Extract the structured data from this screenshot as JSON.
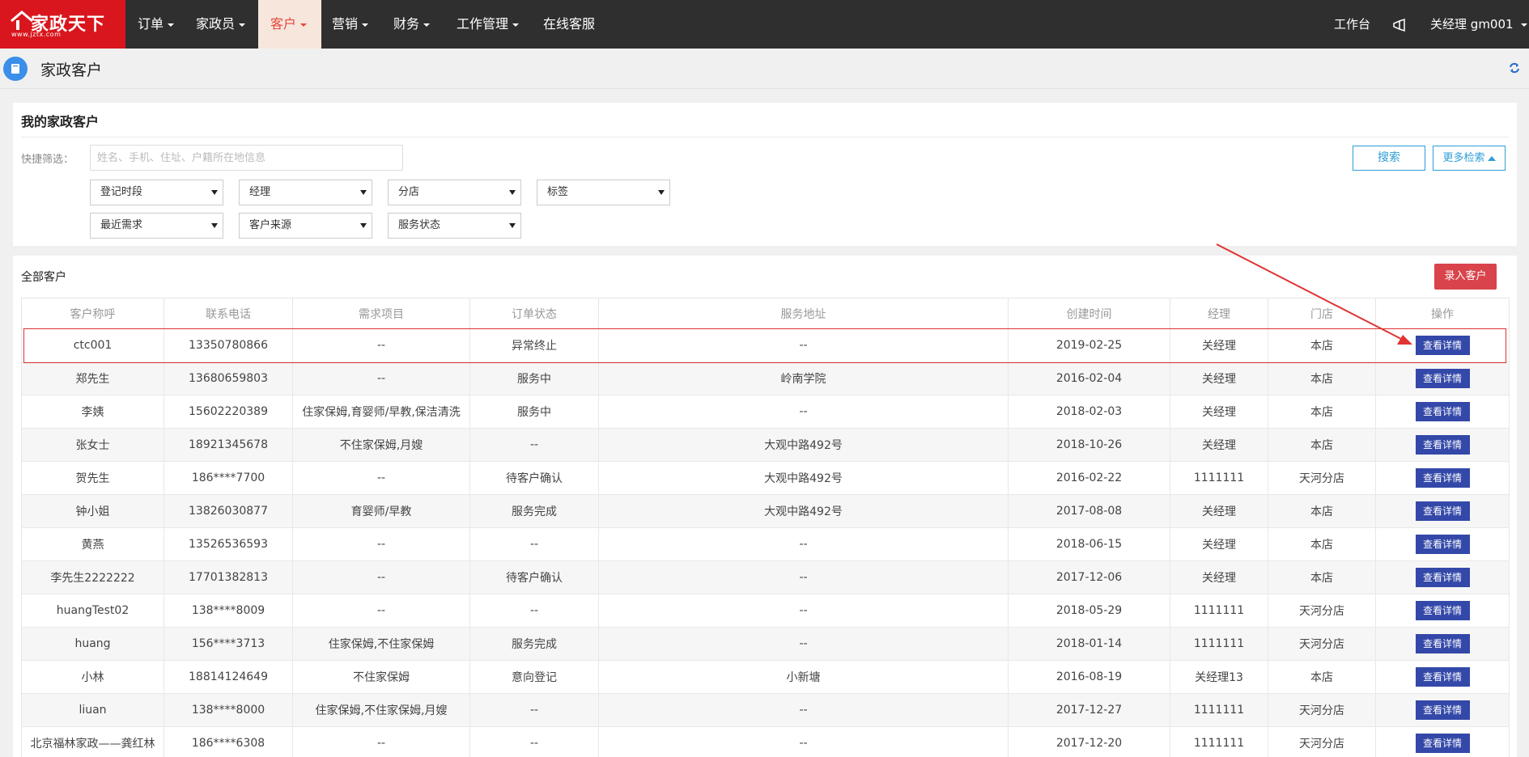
{
  "nav": {
    "logo_text": "家政天下",
    "logo_url": "www.jztx.com",
    "items": [
      {
        "label": "订单",
        "dropdown": true
      },
      {
        "label": "家政员",
        "dropdown": true
      },
      {
        "label": "客户",
        "dropdown": true,
        "active": true
      },
      {
        "label": "营销",
        "dropdown": true
      },
      {
        "label": "财务",
        "dropdown": true
      },
      {
        "label": "工作管理",
        "dropdown": true
      },
      {
        "label": "在线客服",
        "dropdown": false
      }
    ],
    "workbench": "工作台",
    "user": "关经理",
    "user_id": "gm001"
  },
  "page": {
    "title": "家政客户"
  },
  "filter": {
    "title": "我的家政客户",
    "quick_label": "快捷筛选：",
    "quick_placeholder": "姓名、手机、住址、户籍所在地信息",
    "search_label": "搜索",
    "more_label": "更多检索",
    "selects_row1": [
      "登记时段",
      "经理",
      "分店",
      "标签"
    ],
    "selects_row2": [
      "最近需求",
      "客户来源",
      "服务状态"
    ]
  },
  "table_panel": {
    "title": "全部客户",
    "add_label": "录入客户",
    "detail_label": "查看详情",
    "columns": [
      "客户称呼",
      "联系电话",
      "需求项目",
      "订单状态",
      "服务地址",
      "创建时间",
      "经理",
      "门店",
      "操作"
    ],
    "rows": [
      [
        "ctc001",
        "13350780866",
        "--",
        "异常终止",
        "--",
        "2019-02-25",
        "关经理",
        "本店"
      ],
      [
        "郑先生",
        "13680659803",
        "--",
        "服务中",
        "岭南学院",
        "2016-02-04",
        "关经理",
        "本店"
      ],
      [
        "李姨",
        "15602220389",
        "住家保姆,育婴师/早教,保洁清洗",
        "服务中",
        "--",
        "2018-02-03",
        "关经理",
        "本店"
      ],
      [
        "张女士",
        "18921345678",
        "不住家保姆,月嫂",
        "--",
        "大观中路492号",
        "2018-10-26",
        "关经理",
        "本店"
      ],
      [
        "贺先生",
        "186****7700",
        "--",
        "待客户确认",
        "大观中路492号",
        "2016-02-22",
        "1111111",
        "天河分店"
      ],
      [
        "钟小姐",
        "13826030877",
        "育婴师/早教",
        "服务完成",
        "大观中路492号",
        "2017-08-08",
        "关经理",
        "本店"
      ],
      [
        "黄燕",
        "13526536593",
        "--",
        "--",
        "--",
        "2018-06-15",
        "关经理",
        "本店"
      ],
      [
        "李先生2222222",
        "17701382813",
        "--",
        "待客户确认",
        "--",
        "2017-12-06",
        "关经理",
        "本店"
      ],
      [
        "huangTest02",
        "138****8009",
        "--",
        "--",
        "--",
        "2018-05-29",
        "1111111",
        "天河分店"
      ],
      [
        "huang",
        "156****3713",
        "住家保姆,不住家保姆",
        "服务完成",
        "--",
        "2018-01-14",
        "1111111",
        "天河分店"
      ],
      [
        "小林",
        "18814124649",
        "不住家保姆",
        "意向登记",
        "小新塘",
        "2016-08-19",
        "关经理13",
        "本店"
      ],
      [
        "liuan",
        "138****8000",
        "住家保姆,不住家保姆,月嫂",
        "--",
        "--",
        "2017-12-27",
        "1111111",
        "天河分店"
      ],
      [
        "北京福林家政——龚红林",
        "186****6308",
        "--",
        "--",
        "--",
        "2017-12-20",
        "1111111",
        "天河分店"
      ]
    ]
  },
  "colors": {
    "nav_bg": "#2f2f2f",
    "brand_red": "#d9161d",
    "active_tab_bg": "#f7e6dc",
    "detail_btn": "#3348a8",
    "add_btn": "#d9434b",
    "outline_blue": "#2e9ed6",
    "annotation_red": "#e03333"
  }
}
